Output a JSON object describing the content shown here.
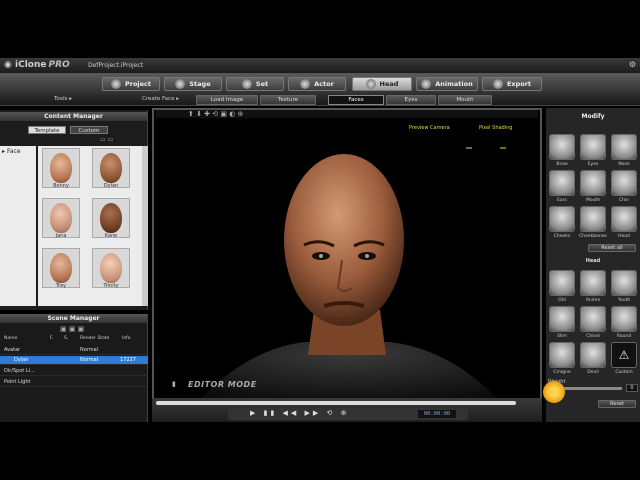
{
  "app": {
    "logo": "iClone",
    "edition": "PRO",
    "project_name": "DefProject.iProject"
  },
  "main_tabs": [
    {
      "label": "Project",
      "active": false,
      "icon": "project-icon"
    },
    {
      "label": "Stage",
      "active": false,
      "icon": "stage-icon"
    },
    {
      "label": "Set",
      "active": false,
      "icon": "set-icon"
    },
    {
      "label": "Actor",
      "active": false,
      "icon": "actor-icon"
    },
    {
      "label": "Head",
      "active": true,
      "icon": "head-icon"
    },
    {
      "label": "Animation",
      "active": false,
      "icon": "animation-icon"
    },
    {
      "label": "Export",
      "active": false,
      "icon": "export-icon"
    }
  ],
  "sub_toolbar": {
    "tools_label": "Tools ▸",
    "create_face_label": "Create Face ▸",
    "buttons": [
      {
        "label": "Load Image",
        "active": false
      },
      {
        "label": "Texture",
        "active": false
      },
      {
        "label": "Faces",
        "active": true
      },
      {
        "label": "Eyes",
        "active": false
      },
      {
        "label": "Mouth",
        "active": false
      }
    ]
  },
  "content_manager": {
    "title": "Content Manager",
    "tabs": [
      "Template",
      "Custom"
    ],
    "tree_item": "Face",
    "thumbnails": [
      "Benny",
      "Dylan",
      "Jana",
      "Kane",
      "Trey",
      "Trinity"
    ]
  },
  "scene_manager": {
    "title": "Scene Manager",
    "columns": [
      "Name",
      "F.",
      "S.",
      "Render State",
      "Info"
    ],
    "rows": [
      {
        "name": "Avatar",
        "state": "Normal",
        "info": "",
        "selected": false
      },
      {
        "name": "Dylan",
        "state": "Normal",
        "info": "17227",
        "selected": true
      },
      {
        "name": "Dir/Spot Li...",
        "state": "",
        "info": "",
        "selected": false
      },
      {
        "name": "Point Light",
        "state": "",
        "info": "",
        "selected": false
      }
    ]
  },
  "viewport": {
    "preview_camera": "Preview Camera",
    "pixel_shading": "Pixel Shading",
    "mode_label": "EDITOR MODE",
    "frame_counter": "00:00:00"
  },
  "modify_panel": {
    "title": "Modify",
    "features": [
      "Brow",
      "Eyes",
      "Nose",
      "Ears",
      "Mouth",
      "Chin",
      "Cheeks",
      "Cheekbones",
      "Head"
    ],
    "reset_all": "Reset all",
    "head_section": "Head",
    "head_styles": [
      "Old",
      "Anime",
      "Youth",
      "Slim",
      "Chisel",
      "Round",
      "Cmigne",
      "Devil",
      "Custom"
    ],
    "weight_label": "Weight",
    "weight_value": "0",
    "reset": "Reset"
  },
  "colors": {
    "accent_yellow": "#e8d840",
    "selection_blue": "#2e7bd8",
    "active_tab": "#dcdcdc"
  }
}
